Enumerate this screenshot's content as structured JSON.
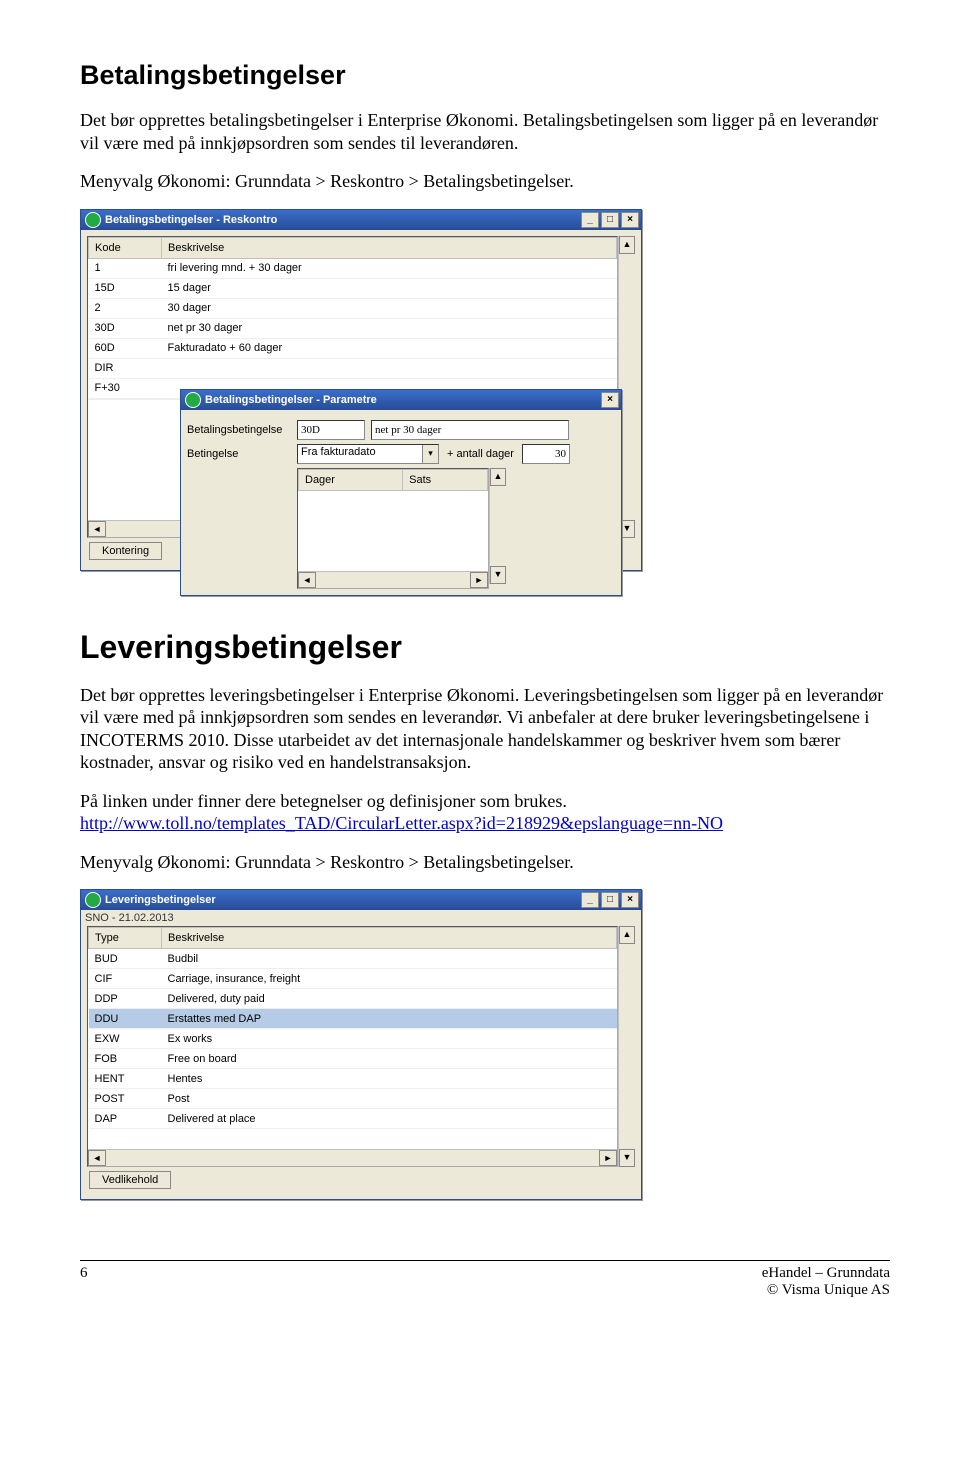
{
  "section1": {
    "title": "Betalingsbetingelser",
    "para1": "Det bør opprettes betalingsbetingelser i Enterprise Økonomi. Betalingsbetingelsen som ligger på en leverandør vil være med på innkjøpsordren som sendes til leverandøren.",
    "para2": "Menyvalg Økonomi: Grunndata > Reskontro > Betalingsbetingelser."
  },
  "win1": {
    "title": "Betalingsbetingelser - Reskontro",
    "colKode": "Kode",
    "colBesk": "Beskrivelse",
    "rows": [
      {
        "k": "1",
        "b": "fri levering mnd. + 30 dager"
      },
      {
        "k": "15D",
        "b": "15 dager"
      },
      {
        "k": "2",
        "b": "30 dager"
      },
      {
        "k": "30D",
        "b": "net pr 30 dager"
      },
      {
        "k": "60D",
        "b": "Fakturadato + 60 dager"
      },
      {
        "k": "DIR",
        "b": ""
      },
      {
        "k": "F+30",
        "b": ""
      }
    ],
    "btnKontering": "Kontering"
  },
  "win1b": {
    "title": "Betalingsbetingelser - Parametre",
    "lblBet": "Betalingsbetingelse",
    "valCode": "30D",
    "valDesc": "net pr 30 dager",
    "lblBeting": "Betingelse",
    "comboVal": "Fra fakturadato",
    "lblAntall": "+ antall dager",
    "valAntall": "30",
    "colDager": "Dager",
    "colSats": "Sats"
  },
  "section2": {
    "title": "Leveringsbetingelser",
    "para1": "Det bør opprettes leveringsbetingelser i Enterprise Økonomi. Leveringsbetingelsen som ligger på en leverandør vil være med på innkjøpsordren som sendes en leverandør. Vi anbefaler at dere bruker leveringsbetingelsene i INCOTERMS 2010. Disse utarbeidet av det internasjonale handelskammer og beskriver hvem som bærer kostnader, ansvar og risiko ved en handelstransaksjon.",
    "para2pre": "På linken under finner dere betegnelser og definisjoner som brukes.",
    "link": "http://www.toll.no/templates_TAD/CircularLetter.aspx?id=218929&epslanguage=nn-NO",
    "para3": "Menyvalg Økonomi: Grunndata > Reskontro > Betalingsbetingelser."
  },
  "win2": {
    "title": "Leveringsbetingelser",
    "sub": "SNO - 21.02.2013",
    "colType": "Type",
    "colBesk": "Beskrivelse",
    "rows": [
      {
        "t": "BUD",
        "b": "Budbil"
      },
      {
        "t": "CIF",
        "b": "Carriage, insurance, freight"
      },
      {
        "t": "DDP",
        "b": "Delivered, duty paid"
      },
      {
        "t": "DDU",
        "b": "Erstattes med DAP"
      },
      {
        "t": "EXW",
        "b": "Ex works"
      },
      {
        "t": "FOB",
        "b": "Free on board"
      },
      {
        "t": "HENT",
        "b": "Hentes"
      },
      {
        "t": "POST",
        "b": "Post"
      },
      {
        "t": "DAP",
        "b": "Delivered at place"
      }
    ],
    "btnVedlikehold": "Vedlikehold"
  },
  "footer": {
    "page": "6",
    "line1": "eHandel – Grunndata",
    "line2": "© Visma Unique AS"
  }
}
